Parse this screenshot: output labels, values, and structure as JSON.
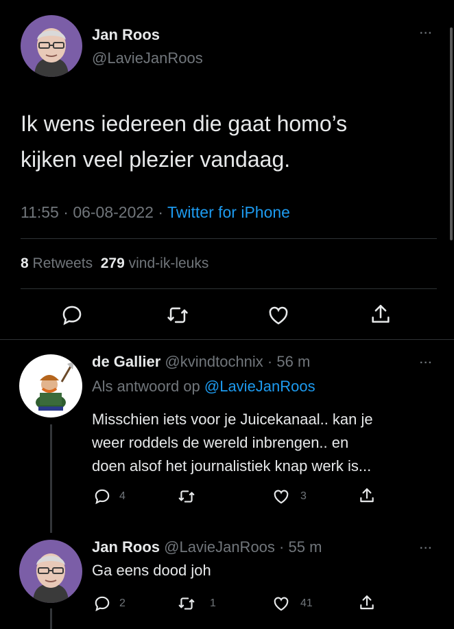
{
  "main_tweet": {
    "author_name": "Jan Roos",
    "author_handle": "@LavieJanRoos",
    "more_label": "···",
    "text_line1": "Ik wens iedereen die gaat homo’s",
    "text_line2": "kijken veel plezier vandaag.",
    "time": "11:55",
    "sep1": " · ",
    "date": "06-08-2022",
    "sep2": " · ",
    "source": "Twitter for iPhone",
    "retweet_count": "8",
    "retweet_label": "Retweets",
    "like_count": "279",
    "like_label": "vind-ik-leuks",
    "actions": [
      "reply-icon",
      "retweet-icon",
      "like-icon",
      "share-icon"
    ]
  },
  "replies": [
    {
      "author_name": "de Gallier",
      "author_handle": "@kvindtochnix",
      "sep": " · ",
      "age": "56 m",
      "reply_to_prefix": "Als antwoord op ",
      "reply_to_handle": "@LavieJanRoos",
      "text_line1": "Misschien iets voor je Juicekanaal.. kan je",
      "text_line2": "weer roddels de wereld inbrengen.. en",
      "text_line3": "doen alsof het journalistiek knap werk is...",
      "reply_count": "4",
      "retweet_count": "",
      "like_count": "3",
      "more_label": "···"
    },
    {
      "author_name": "Jan Roos",
      "author_handle": "@LavieJanRoos",
      "sep": " · ",
      "age": "55 m",
      "text_line1": "Ga eens dood joh",
      "reply_count": "2",
      "retweet_count": "1",
      "like_count": "41",
      "more_label": "···"
    }
  ],
  "colors": {
    "background": "#000000",
    "text": "#e7e9ea",
    "muted": "#71767b",
    "link": "#1d9bf0",
    "avatar_bg": "#7b5ea7"
  }
}
